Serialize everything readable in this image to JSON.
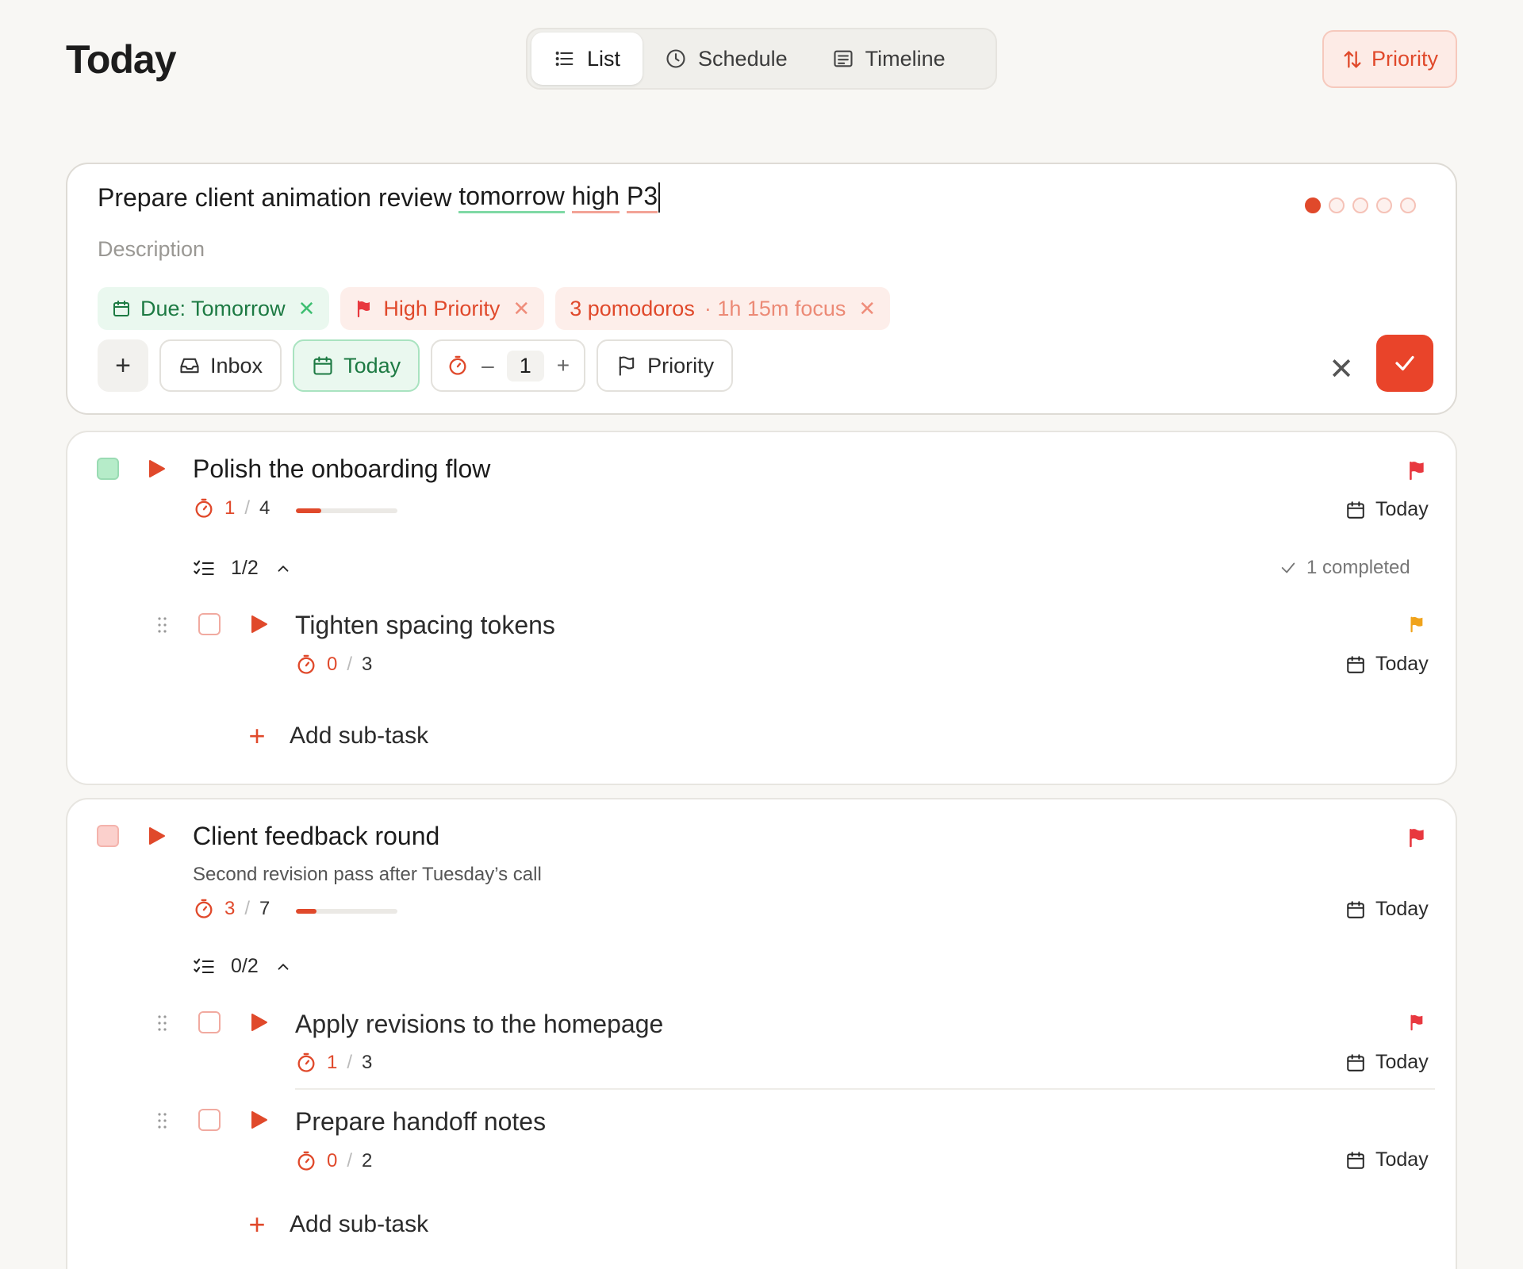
{
  "header": {
    "title": "Today",
    "views": [
      {
        "label": "List",
        "icon": "list-icon",
        "active": true
      },
      {
        "label": "Schedule",
        "icon": "clock-icon",
        "active": false
      },
      {
        "label": "Timeline",
        "icon": "timeline-icon",
        "active": false
      }
    ],
    "sort_label": "Priority"
  },
  "compose": {
    "title_plain": "Prepare client animation review ",
    "token_due": "tomorrow",
    "token_priority": "high",
    "token_project": "P3",
    "description_placeholder": "Description",
    "chips": {
      "due": "Due: Tomorrow",
      "priority": "High Priority",
      "pomodoros_main": "3 pomodoros",
      "pomodoros_sub": "· 1h 15m focus"
    },
    "toolbar": {
      "add": "+",
      "inbox": "Inbox",
      "today": "Today",
      "pomo_minus": "–",
      "pomo_value": "1",
      "pomo_plus": "+",
      "priority": "Priority"
    },
    "cancel": "✕"
  },
  "tasks": [
    {
      "title": "Polish the onboarding flow",
      "pomo_done": "1",
      "pomo_slash": "/",
      "pomo_total": "4",
      "progress": 0.25,
      "date": "Today",
      "subtask_count": "1/2",
      "completed_note": "1 completed",
      "subtasks": [
        {
          "title": "Tighten spacing tokens",
          "pomo_done": "0",
          "pomo_total": "3",
          "date": "Today",
          "flag_color": "#f0a31b"
        }
      ],
      "add_sub": "Add sub-task"
    },
    {
      "title": "Client feedback round",
      "description": "Second revision pass after Tuesday’s call",
      "pomo_done": "3",
      "pomo_slash": "/",
      "pomo_total": "7",
      "progress": 0.2,
      "date": "Today",
      "subtask_count": "0/2",
      "subtasks": [
        {
          "title": "Apply revisions to the homepage",
          "pomo_done": "1",
          "pomo_total": "3",
          "date": "Today",
          "flag_color": "#e8383f"
        },
        {
          "title": "Prepare handoff notes",
          "pomo_done": "0",
          "pomo_total": "2",
          "date": "Today"
        }
      ],
      "add_sub": "Add sub-task"
    }
  ],
  "colors": {
    "accent": "#e0492b",
    "green": "#1d7a43",
    "flag_red": "#e8383f",
    "flag_orange": "#f0a31b"
  }
}
